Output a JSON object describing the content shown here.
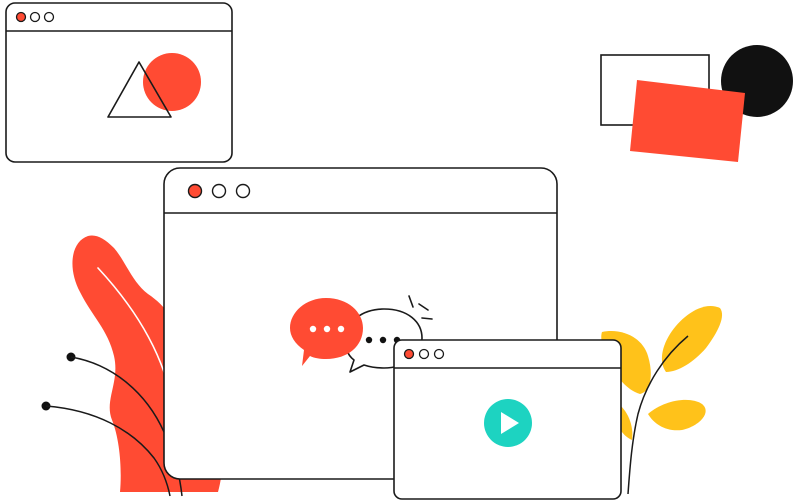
{
  "illustration": {
    "theme": "online video chat / web communication",
    "colors": {
      "red": "#FF4B33",
      "yellow": "#FFC21A",
      "teal": "#1DD3C1",
      "black": "#111111",
      "outline": "#1A1A1A",
      "background": "#FFFFFF"
    },
    "windows": [
      {
        "name": "small-browser-window",
        "content": "triangle-over-circle"
      },
      {
        "name": "main-browser-window",
        "content": "chat-bubbles"
      },
      {
        "name": "video-player-window",
        "content": "play-button"
      }
    ],
    "icons": [
      "chat-bubble-icon",
      "typing-bubble-icon",
      "play-icon",
      "leaf-icon",
      "rectangle-shape",
      "circle-shape"
    ]
  }
}
